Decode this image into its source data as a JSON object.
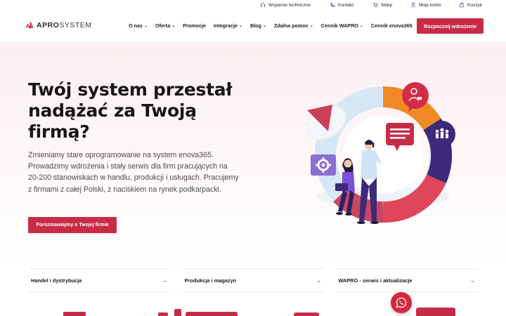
{
  "utility_bar": {
    "items": [
      {
        "label": "Wsparcie techniczne",
        "icon": "headset-icon"
      },
      {
        "label": "Kontakt",
        "icon": "phone-icon"
      },
      {
        "label": "Sklep",
        "icon": "cart-icon"
      },
      {
        "label": "Moje konto",
        "icon": "user-icon"
      },
      {
        "label": "Koszyk",
        "icon": "basket-icon"
      }
    ]
  },
  "header": {
    "logo_bold": "APRO",
    "logo_light": "SYSTEM",
    "nav": [
      {
        "label": "O nas",
        "dropdown": true
      },
      {
        "label": "Oferta",
        "dropdown": true
      },
      {
        "label": "Promocje",
        "dropdown": false
      },
      {
        "label": "Integracje",
        "dropdown": true
      },
      {
        "label": "Blog",
        "dropdown": true
      },
      {
        "label": "Zdalna pomoc",
        "dropdown": true
      },
      {
        "label": "Cennik WAPRO",
        "dropdown": true
      },
      {
        "label": "Cennik enova365",
        "dropdown": false
      }
    ],
    "cta_label": "Rozpocznij wdrożenie"
  },
  "hero": {
    "title": "Twój system przestał nadążać za Twoją firmą?",
    "text": "Zmieniamy stare oprogramowanie na system enova365. Prowadzimy wdrożenia i stały serwis dla firm pracujących na 20-200 stanowiskach w handlu, produkcji i usługach. Pracujemy z firmami z całej Polski, z naciskiem na rynek podkarpacki.",
    "button_label": "Porozmawiajmy o Twojej firmie"
  },
  "categories": [
    {
      "label": "Handel i dystrybucja",
      "arrow": "→"
    },
    {
      "label": "Produkcja i magazyn",
      "arrow": "→"
    },
    {
      "label": "WAPRO - serwis i aktualizacje",
      "arrow": "→"
    }
  ],
  "colors": {
    "brand": "#c72c47",
    "accent_orange": "#f08a24",
    "accent_purple": "#3e2a7a",
    "accent_blue": "#cfe3f5"
  }
}
